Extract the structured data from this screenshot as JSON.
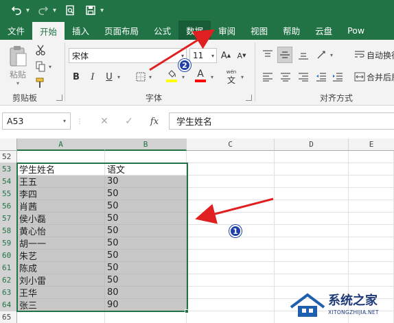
{
  "quick_access": {
    "undo_icon": "undo-icon",
    "redo_icon": "redo-icon",
    "print_preview_icon": "print-preview-icon",
    "save_icon": "save-icon",
    "customize_icon": "chevron-down-icon"
  },
  "tabs": [
    {
      "label": "文件"
    },
    {
      "label": "开始"
    },
    {
      "label": "插入"
    },
    {
      "label": "页面布局"
    },
    {
      "label": "公式"
    },
    {
      "label": "数据"
    },
    {
      "label": "审阅"
    },
    {
      "label": "视图"
    },
    {
      "label": "帮助"
    },
    {
      "label": "云盘"
    },
    {
      "label": "Pow"
    }
  ],
  "ribbon": {
    "clipboard": {
      "paste_label": "粘贴",
      "group_label": "剪贴板"
    },
    "font": {
      "font_name": "宋体",
      "font_size": "11",
      "bold": "B",
      "italic": "I",
      "underline": "U",
      "grow_font": "A",
      "shrink_font": "A",
      "font_color_letter": "A",
      "highlight_color": "#ffff00",
      "font_color": "#ff0000",
      "phonetic_label": "wén",
      "phonetic_char": "文",
      "group_label": "字体"
    },
    "alignment": {
      "wrap_text_label": "自动换行",
      "merge_label": "合并后居",
      "group_label": "对齐方式"
    }
  },
  "formula_bar": {
    "name_box": "A53",
    "cancel": "✕",
    "enter": "✓",
    "fx": "fx",
    "content": "学生姓名"
  },
  "sheet": {
    "columns": [
      "A",
      "B",
      "C",
      "D",
      "E"
    ],
    "rows": [
      "52",
      "53",
      "54",
      "55",
      "56",
      "57",
      "58",
      "59",
      "60",
      "61",
      "62",
      "63",
      "64",
      "65"
    ],
    "data": [
      [
        "",
        ""
      ],
      [
        "学生姓名",
        "语文"
      ],
      [
        "王五",
        "30"
      ],
      [
        "李四",
        "50"
      ],
      [
        "肖茜",
        "50"
      ],
      [
        "侯小磊",
        "50"
      ],
      [
        "黄心怡",
        "50"
      ],
      [
        "胡一一",
        "50"
      ],
      [
        "朱艺",
        "50"
      ],
      [
        "陈成",
        "50"
      ],
      [
        "刘小雷",
        "50"
      ],
      [
        "王华",
        "80"
      ],
      [
        "张三",
        "90"
      ],
      [
        "",
        ""
      ]
    ]
  },
  "annotations": {
    "step1": "1",
    "step2": "2",
    "arrow_color": "#e02020"
  },
  "watermark": {
    "title": "系统之家",
    "url": "XITONGZHIJIA.NET"
  },
  "colors": {
    "accent": "#217346",
    "selection": "#c8c8c8",
    "badge": "#1e3fa8"
  }
}
